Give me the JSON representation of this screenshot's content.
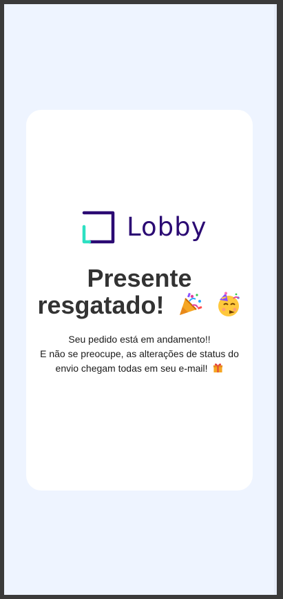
{
  "brand": {
    "name": "Lobby",
    "colors": {
      "primary": "#2b0a73",
      "accent": "#2de0c2"
    }
  },
  "page": {
    "background": "#eef4ff",
    "card_background": "#ffffff"
  },
  "title": {
    "line1": "Presente",
    "line2": "resgatado!",
    "emojis": [
      "party-popper",
      "partying-face"
    ]
  },
  "message": {
    "line1": "Seu pedido está em andamento!!",
    "line2": "E não se preocupe, as alterações de status do",
    "line3": "envio chegam todas em seu e-mail!",
    "trailing_icon": "gift"
  }
}
